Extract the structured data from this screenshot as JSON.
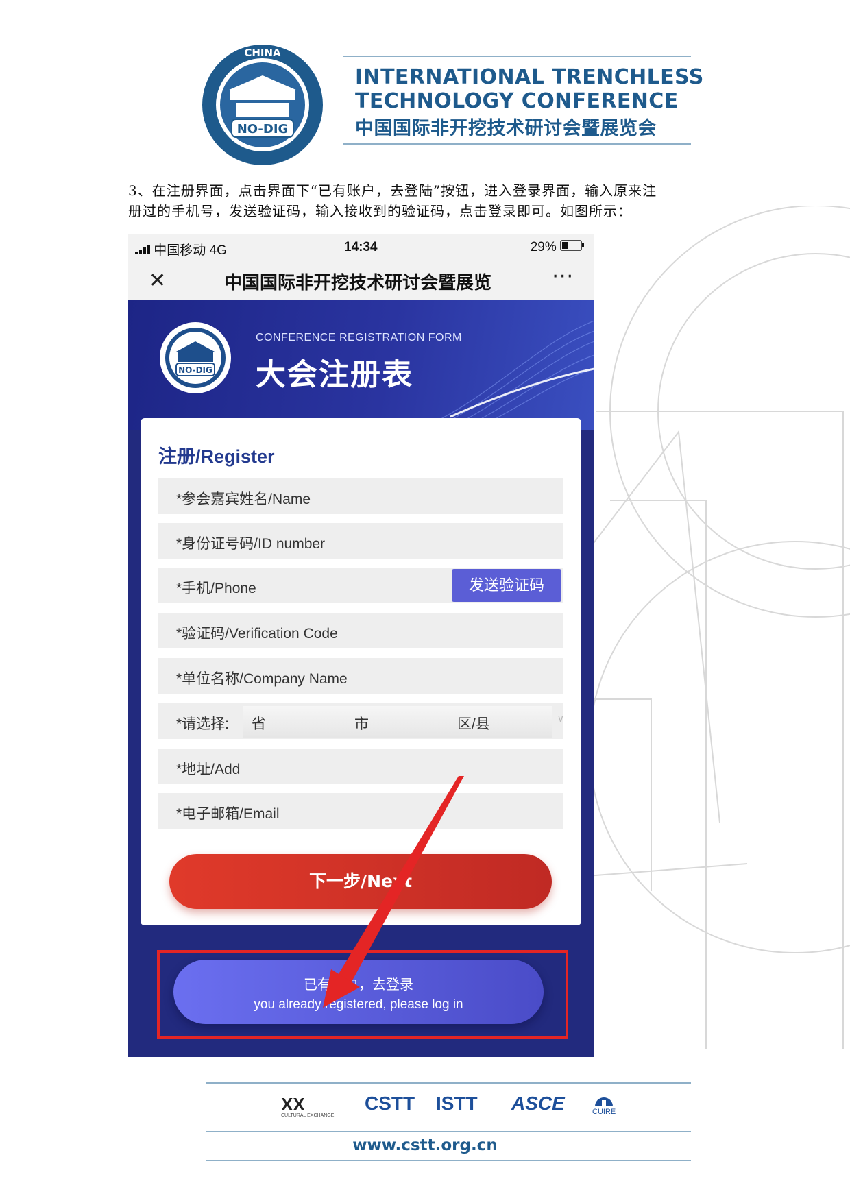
{
  "header": {
    "seal_text": "CHINA",
    "seal_badge": "NO-DIG",
    "title_line_1": "INTERNATIONAL TRENCHLESS",
    "title_line_2": "TECHNOLOGY CONFERENCE",
    "title_cn": "中国国际非开挖技术研讨会暨展览会"
  },
  "instructions": {
    "line_1": "3、在注册界面，点击界面下“已有账户，去登陆”按钮，进入登录界面，输入原来注",
    "line_2": "册过的手机号，发送验证码，输入接收到的验证码，点击登录即可。如图所示："
  },
  "phone": {
    "status_bar": {
      "carrier": "中国移动  4G",
      "time": "14:34",
      "battery": "29%"
    },
    "nav": {
      "close_glyph": "✕",
      "title": "中国国际非开挖技术研讨会暨展览",
      "more_glyph": "···"
    },
    "banner": {
      "subtitle": "CONFERENCE REGISTRATION FORM",
      "title": "大会注册表",
      "logo_badge": "NO-DIG"
    },
    "form": {
      "heading": "注册/Register",
      "fields": {
        "name": "*参会嘉宾姓名/Name",
        "id_number": "*身份证号码/ID number",
        "phone": "*手机/Phone",
        "verification_code": "*验证码/Verification Code",
        "company": "*单位名称/Company Name",
        "region_label": "*请选择:",
        "address": "*地址/Add",
        "email": "*电子邮箱/Email"
      },
      "send_code_label": "发送验证码",
      "selects": {
        "province": "省",
        "city": "市",
        "district": "区/县"
      },
      "next_label": "下一步/Next"
    },
    "login": {
      "label_cn": "已有账户，去登录",
      "label_en": "you already registered, please log in"
    },
    "colors": {
      "page_bg": "#222a7e",
      "next_button": "#d4322a",
      "login_button": "#5b5ed6",
      "highlight_box": "#e42525"
    }
  },
  "footer": {
    "sponsor_1": "XX",
    "sponsor_1_sub": "CULTURAL EXCHANGE",
    "sponsor_2": "CSTT",
    "sponsor_3": "ISTT",
    "sponsor_4": "ASCE",
    "sponsor_5": "CUIRE",
    "url": "www.cstt.org.cn"
  }
}
